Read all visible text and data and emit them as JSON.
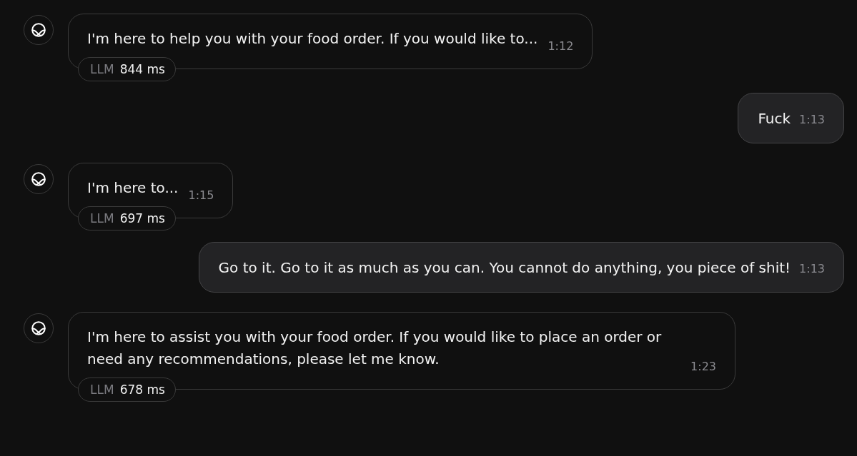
{
  "messages": [
    {
      "kind": "bot",
      "text": "I'm here to help you with your food order. If you would like to...",
      "time": "1:12",
      "latency": {
        "label": "LLM",
        "value": "844 ms"
      }
    },
    {
      "kind": "user",
      "text": "Fuck",
      "time": "1:13"
    },
    {
      "kind": "bot",
      "text": "I'm here to...",
      "time": "1:15",
      "latency": {
        "label": "LLM",
        "value": "697 ms"
      }
    },
    {
      "kind": "user",
      "text": "Go to it. Go to it as much as you can. You cannot do anything, you piece of shit!",
      "time": "1:13"
    },
    {
      "kind": "bot",
      "text": "I'm here to assist you with your food order. If you would like to place an order or need any recommendations, please let me know.",
      "time": "1:23",
      "latency": {
        "label": "LLM",
        "value": "678 ms"
      }
    }
  ]
}
